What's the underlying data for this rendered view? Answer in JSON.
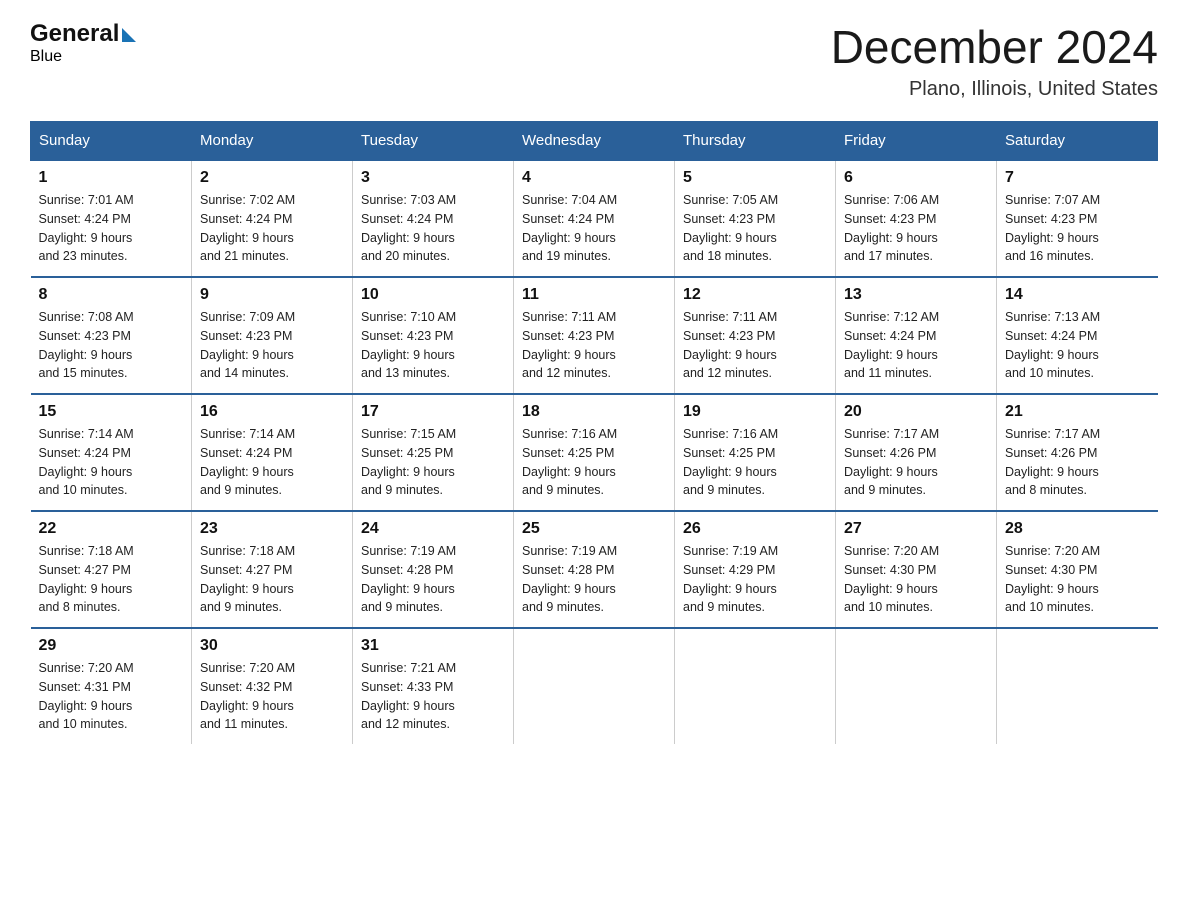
{
  "header": {
    "month": "December 2024",
    "location": "Plano, Illinois, United States"
  },
  "days_of_week": [
    "Sunday",
    "Monday",
    "Tuesday",
    "Wednesday",
    "Thursday",
    "Friday",
    "Saturday"
  ],
  "weeks": [
    [
      {
        "day": "1",
        "sunrise": "7:01 AM",
        "sunset": "4:24 PM",
        "daylight": "9 hours and 23 minutes."
      },
      {
        "day": "2",
        "sunrise": "7:02 AM",
        "sunset": "4:24 PM",
        "daylight": "9 hours and 21 minutes."
      },
      {
        "day": "3",
        "sunrise": "7:03 AM",
        "sunset": "4:24 PM",
        "daylight": "9 hours and 20 minutes."
      },
      {
        "day": "4",
        "sunrise": "7:04 AM",
        "sunset": "4:24 PM",
        "daylight": "9 hours and 19 minutes."
      },
      {
        "day": "5",
        "sunrise": "7:05 AM",
        "sunset": "4:23 PM",
        "daylight": "9 hours and 18 minutes."
      },
      {
        "day": "6",
        "sunrise": "7:06 AM",
        "sunset": "4:23 PM",
        "daylight": "9 hours and 17 minutes."
      },
      {
        "day": "7",
        "sunrise": "7:07 AM",
        "sunset": "4:23 PM",
        "daylight": "9 hours and 16 minutes."
      }
    ],
    [
      {
        "day": "8",
        "sunrise": "7:08 AM",
        "sunset": "4:23 PM",
        "daylight": "9 hours and 15 minutes."
      },
      {
        "day": "9",
        "sunrise": "7:09 AM",
        "sunset": "4:23 PM",
        "daylight": "9 hours and 14 minutes."
      },
      {
        "day": "10",
        "sunrise": "7:10 AM",
        "sunset": "4:23 PM",
        "daylight": "9 hours and 13 minutes."
      },
      {
        "day": "11",
        "sunrise": "7:11 AM",
        "sunset": "4:23 PM",
        "daylight": "9 hours and 12 minutes."
      },
      {
        "day": "12",
        "sunrise": "7:11 AM",
        "sunset": "4:23 PM",
        "daylight": "9 hours and 12 minutes."
      },
      {
        "day": "13",
        "sunrise": "7:12 AM",
        "sunset": "4:24 PM",
        "daylight": "9 hours and 11 minutes."
      },
      {
        "day": "14",
        "sunrise": "7:13 AM",
        "sunset": "4:24 PM",
        "daylight": "9 hours and 10 minutes."
      }
    ],
    [
      {
        "day": "15",
        "sunrise": "7:14 AM",
        "sunset": "4:24 PM",
        "daylight": "9 hours and 10 minutes."
      },
      {
        "day": "16",
        "sunrise": "7:14 AM",
        "sunset": "4:24 PM",
        "daylight": "9 hours and 9 minutes."
      },
      {
        "day": "17",
        "sunrise": "7:15 AM",
        "sunset": "4:25 PM",
        "daylight": "9 hours and 9 minutes."
      },
      {
        "day": "18",
        "sunrise": "7:16 AM",
        "sunset": "4:25 PM",
        "daylight": "9 hours and 9 minutes."
      },
      {
        "day": "19",
        "sunrise": "7:16 AM",
        "sunset": "4:25 PM",
        "daylight": "9 hours and 9 minutes."
      },
      {
        "day": "20",
        "sunrise": "7:17 AM",
        "sunset": "4:26 PM",
        "daylight": "9 hours and 9 minutes."
      },
      {
        "day": "21",
        "sunrise": "7:17 AM",
        "sunset": "4:26 PM",
        "daylight": "9 hours and 8 minutes."
      }
    ],
    [
      {
        "day": "22",
        "sunrise": "7:18 AM",
        "sunset": "4:27 PM",
        "daylight": "9 hours and 8 minutes."
      },
      {
        "day": "23",
        "sunrise": "7:18 AM",
        "sunset": "4:27 PM",
        "daylight": "9 hours and 9 minutes."
      },
      {
        "day": "24",
        "sunrise": "7:19 AM",
        "sunset": "4:28 PM",
        "daylight": "9 hours and 9 minutes."
      },
      {
        "day": "25",
        "sunrise": "7:19 AM",
        "sunset": "4:28 PM",
        "daylight": "9 hours and 9 minutes."
      },
      {
        "day": "26",
        "sunrise": "7:19 AM",
        "sunset": "4:29 PM",
        "daylight": "9 hours and 9 minutes."
      },
      {
        "day": "27",
        "sunrise": "7:20 AM",
        "sunset": "4:30 PM",
        "daylight": "9 hours and 10 minutes."
      },
      {
        "day": "28",
        "sunrise": "7:20 AM",
        "sunset": "4:30 PM",
        "daylight": "9 hours and 10 minutes."
      }
    ],
    [
      {
        "day": "29",
        "sunrise": "7:20 AM",
        "sunset": "4:31 PM",
        "daylight": "9 hours and 10 minutes."
      },
      {
        "day": "30",
        "sunrise": "7:20 AM",
        "sunset": "4:32 PM",
        "daylight": "9 hours and 11 minutes."
      },
      {
        "day": "31",
        "sunrise": "7:21 AM",
        "sunset": "4:33 PM",
        "daylight": "9 hours and 12 minutes."
      },
      null,
      null,
      null,
      null
    ]
  ],
  "labels": {
    "sunrise": "Sunrise:",
    "sunset": "Sunset:",
    "daylight": "Daylight:"
  }
}
